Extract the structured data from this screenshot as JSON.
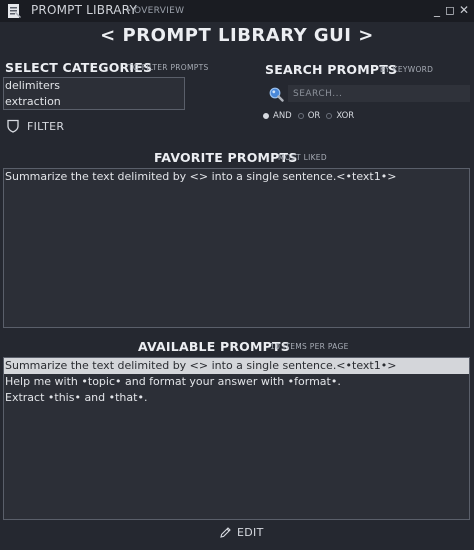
{
  "window": {
    "title": "PROMPT LIBRARY",
    "crumb_arrow": "‣",
    "breadcrumb": "OVERVIEW",
    "min": "_",
    "max": "◻",
    "close": "✕"
  },
  "header": {
    "title": "< PROMPT LIBRARY GUI >"
  },
  "categories": {
    "title": "SELECT CATEGORIES",
    "subtitle": "TO FILTER PROMPTS",
    "items": [
      "delimiters",
      "extraction"
    ],
    "filter_label": "FILTER"
  },
  "search": {
    "title": "SEARCH PROMPTS",
    "subtitle": "BY KEYWORD",
    "placeholder": "SEARCH...",
    "value": "",
    "modes": [
      "AND",
      "OR",
      "XOR"
    ],
    "selected_mode": "AND"
  },
  "favorites": {
    "title": "FAVORITE PROMPTS",
    "subtitle": "MOST LIKED",
    "items": [
      "Summarize the text delimited by <> into a single sentence.<•text1•>"
    ]
  },
  "available": {
    "title": "AVAILABLE PROMPTS",
    "subtitle": "10 ITEMS PER PAGE",
    "items": [
      "Summarize the text delimited by <> into a single sentence.<•text1•>",
      "Help me with •topic• and format your answer with •format•.",
      "Extract •this• and •that•."
    ],
    "selected_index": 0
  },
  "actions": {
    "edit_label": "EDIT"
  },
  "icons": {
    "app": "app-logo-icon",
    "filter": "shield-filter-icon",
    "search": "magnifier-icon",
    "edit": "pencil-icon"
  },
  "colors": {
    "background": "#252830",
    "titlebar": "#1a1c22",
    "panel": "#2c2f37",
    "selection": "#d4d6da",
    "search_icon": "#4a88d8"
  }
}
